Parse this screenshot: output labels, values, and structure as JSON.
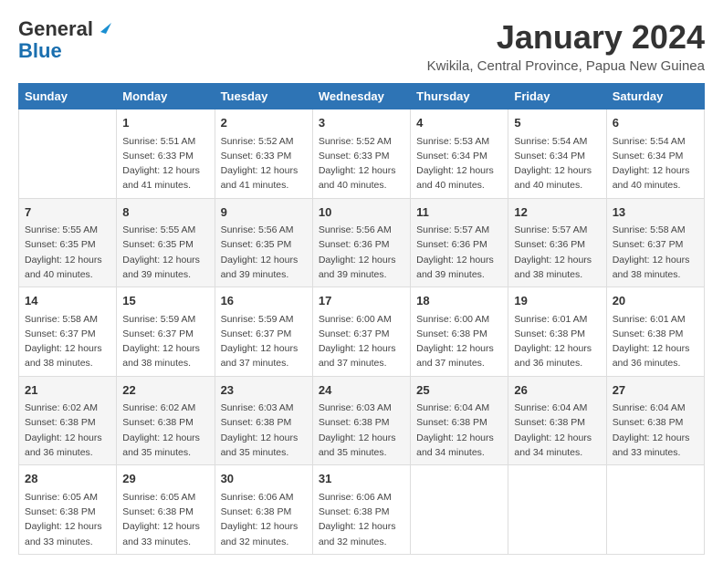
{
  "header": {
    "logo_general": "General",
    "logo_blue": "Blue",
    "month_year": "January 2024",
    "location": "Kwikila, Central Province, Papua New Guinea"
  },
  "days_of_week": [
    "Sunday",
    "Monday",
    "Tuesday",
    "Wednesday",
    "Thursday",
    "Friday",
    "Saturday"
  ],
  "weeks": [
    [
      {
        "day": "",
        "sunrise": "",
        "sunset": "",
        "daylight": ""
      },
      {
        "day": "1",
        "sunrise": "Sunrise: 5:51 AM",
        "sunset": "Sunset: 6:33 PM",
        "daylight": "Daylight: 12 hours and 41 minutes."
      },
      {
        "day": "2",
        "sunrise": "Sunrise: 5:52 AM",
        "sunset": "Sunset: 6:33 PM",
        "daylight": "Daylight: 12 hours and 41 minutes."
      },
      {
        "day": "3",
        "sunrise": "Sunrise: 5:52 AM",
        "sunset": "Sunset: 6:33 PM",
        "daylight": "Daylight: 12 hours and 40 minutes."
      },
      {
        "day": "4",
        "sunrise": "Sunrise: 5:53 AM",
        "sunset": "Sunset: 6:34 PM",
        "daylight": "Daylight: 12 hours and 40 minutes."
      },
      {
        "day": "5",
        "sunrise": "Sunrise: 5:54 AM",
        "sunset": "Sunset: 6:34 PM",
        "daylight": "Daylight: 12 hours and 40 minutes."
      },
      {
        "day": "6",
        "sunrise": "Sunrise: 5:54 AM",
        "sunset": "Sunset: 6:34 PM",
        "daylight": "Daylight: 12 hours and 40 minutes."
      }
    ],
    [
      {
        "day": "7",
        "sunrise": "Sunrise: 5:55 AM",
        "sunset": "Sunset: 6:35 PM",
        "daylight": "Daylight: 12 hours and 40 minutes."
      },
      {
        "day": "8",
        "sunrise": "Sunrise: 5:55 AM",
        "sunset": "Sunset: 6:35 PM",
        "daylight": "Daylight: 12 hours and 39 minutes."
      },
      {
        "day": "9",
        "sunrise": "Sunrise: 5:56 AM",
        "sunset": "Sunset: 6:35 PM",
        "daylight": "Daylight: 12 hours and 39 minutes."
      },
      {
        "day": "10",
        "sunrise": "Sunrise: 5:56 AM",
        "sunset": "Sunset: 6:36 PM",
        "daylight": "Daylight: 12 hours and 39 minutes."
      },
      {
        "day": "11",
        "sunrise": "Sunrise: 5:57 AM",
        "sunset": "Sunset: 6:36 PM",
        "daylight": "Daylight: 12 hours and 39 minutes."
      },
      {
        "day": "12",
        "sunrise": "Sunrise: 5:57 AM",
        "sunset": "Sunset: 6:36 PM",
        "daylight": "Daylight: 12 hours and 38 minutes."
      },
      {
        "day": "13",
        "sunrise": "Sunrise: 5:58 AM",
        "sunset": "Sunset: 6:37 PM",
        "daylight": "Daylight: 12 hours and 38 minutes."
      }
    ],
    [
      {
        "day": "14",
        "sunrise": "Sunrise: 5:58 AM",
        "sunset": "Sunset: 6:37 PM",
        "daylight": "Daylight: 12 hours and 38 minutes."
      },
      {
        "day": "15",
        "sunrise": "Sunrise: 5:59 AM",
        "sunset": "Sunset: 6:37 PM",
        "daylight": "Daylight: 12 hours and 38 minutes."
      },
      {
        "day": "16",
        "sunrise": "Sunrise: 5:59 AM",
        "sunset": "Sunset: 6:37 PM",
        "daylight": "Daylight: 12 hours and 37 minutes."
      },
      {
        "day": "17",
        "sunrise": "Sunrise: 6:00 AM",
        "sunset": "Sunset: 6:37 PM",
        "daylight": "Daylight: 12 hours and 37 minutes."
      },
      {
        "day": "18",
        "sunrise": "Sunrise: 6:00 AM",
        "sunset": "Sunset: 6:38 PM",
        "daylight": "Daylight: 12 hours and 37 minutes."
      },
      {
        "day": "19",
        "sunrise": "Sunrise: 6:01 AM",
        "sunset": "Sunset: 6:38 PM",
        "daylight": "Daylight: 12 hours and 36 minutes."
      },
      {
        "day": "20",
        "sunrise": "Sunrise: 6:01 AM",
        "sunset": "Sunset: 6:38 PM",
        "daylight": "Daylight: 12 hours and 36 minutes."
      }
    ],
    [
      {
        "day": "21",
        "sunrise": "Sunrise: 6:02 AM",
        "sunset": "Sunset: 6:38 PM",
        "daylight": "Daylight: 12 hours and 36 minutes."
      },
      {
        "day": "22",
        "sunrise": "Sunrise: 6:02 AM",
        "sunset": "Sunset: 6:38 PM",
        "daylight": "Daylight: 12 hours and 35 minutes."
      },
      {
        "day": "23",
        "sunrise": "Sunrise: 6:03 AM",
        "sunset": "Sunset: 6:38 PM",
        "daylight": "Daylight: 12 hours and 35 minutes."
      },
      {
        "day": "24",
        "sunrise": "Sunrise: 6:03 AM",
        "sunset": "Sunset: 6:38 PM",
        "daylight": "Daylight: 12 hours and 35 minutes."
      },
      {
        "day": "25",
        "sunrise": "Sunrise: 6:04 AM",
        "sunset": "Sunset: 6:38 PM",
        "daylight": "Daylight: 12 hours and 34 minutes."
      },
      {
        "day": "26",
        "sunrise": "Sunrise: 6:04 AM",
        "sunset": "Sunset: 6:38 PM",
        "daylight": "Daylight: 12 hours and 34 minutes."
      },
      {
        "day": "27",
        "sunrise": "Sunrise: 6:04 AM",
        "sunset": "Sunset: 6:38 PM",
        "daylight": "Daylight: 12 hours and 33 minutes."
      }
    ],
    [
      {
        "day": "28",
        "sunrise": "Sunrise: 6:05 AM",
        "sunset": "Sunset: 6:38 PM",
        "daylight": "Daylight: 12 hours and 33 minutes."
      },
      {
        "day": "29",
        "sunrise": "Sunrise: 6:05 AM",
        "sunset": "Sunset: 6:38 PM",
        "daylight": "Daylight: 12 hours and 33 minutes."
      },
      {
        "day": "30",
        "sunrise": "Sunrise: 6:06 AM",
        "sunset": "Sunset: 6:38 PM",
        "daylight": "Daylight: 12 hours and 32 minutes."
      },
      {
        "day": "31",
        "sunrise": "Sunrise: 6:06 AM",
        "sunset": "Sunset: 6:38 PM",
        "daylight": "Daylight: 12 hours and 32 minutes."
      },
      {
        "day": "",
        "sunrise": "",
        "sunset": "",
        "daylight": ""
      },
      {
        "day": "",
        "sunrise": "",
        "sunset": "",
        "daylight": ""
      },
      {
        "day": "",
        "sunrise": "",
        "sunset": "",
        "daylight": ""
      }
    ]
  ]
}
